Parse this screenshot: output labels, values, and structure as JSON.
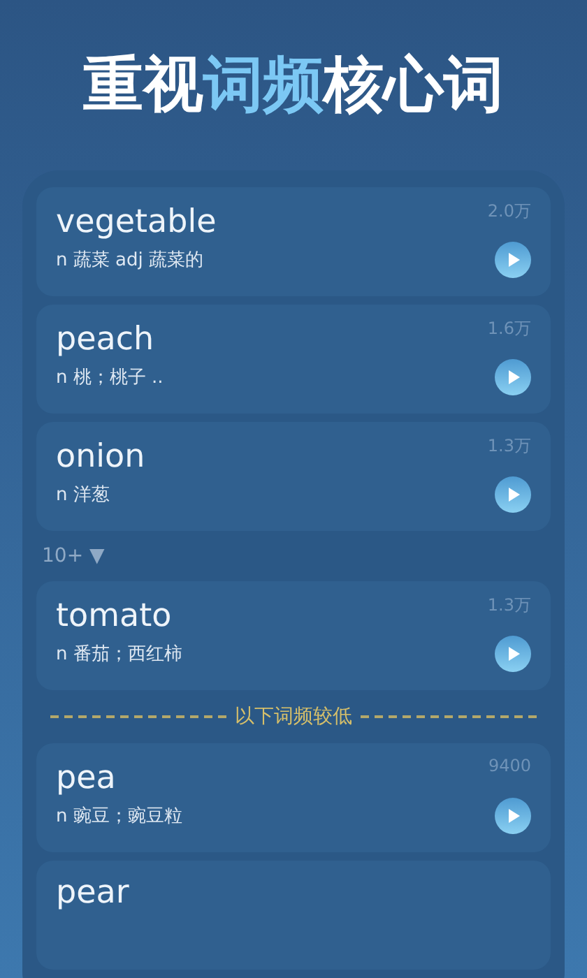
{
  "title": [
    {
      "text": "重视",
      "highlighted": false
    },
    {
      "text": "词频",
      "highlighted": true
    },
    {
      "text": "核心词",
      "highlighted": false
    }
  ],
  "list": [
    {
      "kind": "word",
      "word": "vegetable",
      "meaning": "n 蔬菜 adj 蔬菜的",
      "count": "2.0万"
    },
    {
      "kind": "word",
      "word": "peach",
      "meaning": "n 桃；桃子 ..",
      "count": "1.6万"
    },
    {
      "kind": "word",
      "word": "onion",
      "meaning": "n 洋葱",
      "count": "1.3万"
    },
    {
      "kind": "more",
      "text": "10+ ▼"
    },
    {
      "kind": "word",
      "word": "tomato",
      "meaning": "n 番茄；西红柿",
      "count": "1.3万"
    },
    {
      "kind": "divider",
      "text": "以下词频较低"
    },
    {
      "kind": "word",
      "word": "pea",
      "meaning": "n 豌豆；豌豆粒",
      "count": "9400"
    },
    {
      "kind": "partial",
      "word": "pear"
    }
  ]
}
